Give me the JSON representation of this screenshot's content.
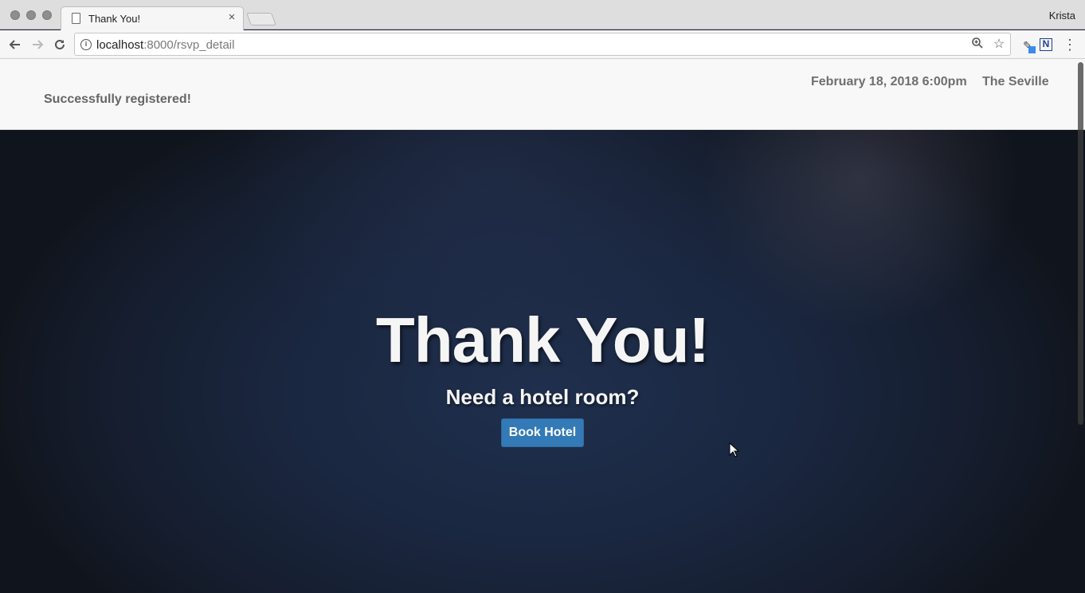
{
  "browser": {
    "tab_title": "Thank You!",
    "tab_close": "×",
    "profile_name": "Krista",
    "url_host": "localhost",
    "url_path": ":8000/rsvp_detail",
    "icons": {
      "back": "back-arrow-icon",
      "forward": "forward-arrow-icon",
      "reload": "reload-icon",
      "info": "info-icon",
      "zoom": "zoom-icon",
      "bookmark": "star-icon",
      "extension_pen": "pen-extension-icon",
      "extension_n": "n-extension-icon",
      "menu": "more-vert-icon"
    }
  },
  "page": {
    "header": {
      "status_message": "Successfully registered!",
      "event_date": "February 18, 2018 6:00pm",
      "event_venue": "The Seville"
    },
    "hero": {
      "title": "Thank You!",
      "subtitle": "Need a hotel room?",
      "button_label": "Book Hotel"
    }
  },
  "colors": {
    "button": "#337ab7",
    "hero_background": "#1b2436",
    "header_background": "#f8f8f8"
  }
}
